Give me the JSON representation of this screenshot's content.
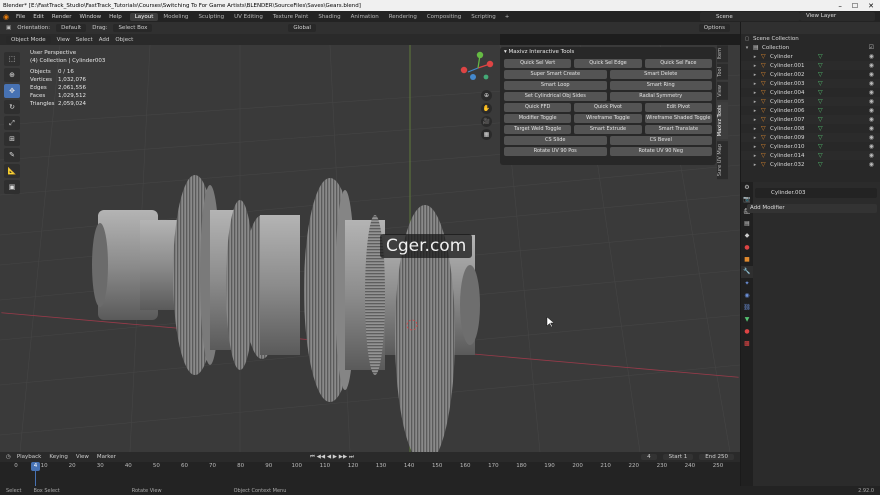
{
  "titlebar": {
    "title": "Blender* [E:\\FastTrack_Studio\\FastTrack_Tutorials\\Courses\\Switching To For Game Artists\\BLENDER\\SourceFiles\\Saves\\Gears.blend]"
  },
  "menu": [
    "File",
    "Edit",
    "Render",
    "Window",
    "Help"
  ],
  "workspaces": [
    "Layout",
    "Modeling",
    "Sculpting",
    "UV Editing",
    "Texture Paint",
    "Shading",
    "Animation",
    "Rendering",
    "Compositing",
    "Scripting"
  ],
  "active_workspace": "Layout",
  "scene": "Scene",
  "view_layer": "View Layer",
  "header1": {
    "orientation_label": "Orientation:",
    "orientation": "Default",
    "drag_label": "Drag:",
    "drag": "Select Box",
    "transform": "Global",
    "options": "Options"
  },
  "header2": {
    "mode": "Object Mode",
    "view": "View",
    "select": "Select",
    "add": "Add",
    "object": "Object"
  },
  "stats": {
    "view_name": "User Perspective",
    "collection": "(4) Collection | Cylinder003",
    "rows": [
      {
        "k": "Objects",
        "v": "0 / 16"
      },
      {
        "k": "Vertices",
        "v": "1,032,076"
      },
      {
        "k": "Edges",
        "v": "2,061,556"
      },
      {
        "k": "Faces",
        "v": "1,029,512"
      },
      {
        "k": "Triangles",
        "v": "2,059,024"
      }
    ]
  },
  "npanel": {
    "title": "Maxivz Interactive Tools",
    "grid3": [
      "Quick Sel Vert",
      "Quick Sel Edge",
      "Quick Sel Face",
      "Super Smart Create",
      "",
      "Smart Delete",
      "Smart Loop",
      "",
      "Smart Ring",
      "Set Cylindrical Obj Sides",
      "",
      "Radial Symmetry",
      "Quick FFD",
      "Quick Pivot",
      "Edit Pivot",
      "Modifier Toggle",
      "Wireframe Toggle",
      "Wireframe Shaded Toggle",
      "Target Weld Toggle",
      "Smart Extrude",
      "Smart Translate",
      "CS Slide",
      "",
      "CS Bevel",
      "Rotate UV 90 Pos",
      "",
      "Rotate UV 90 Neg"
    ]
  },
  "vtabs": [
    "Item",
    "Tool",
    "View",
    "Maxivz Tools",
    "Sure UV Map"
  ],
  "watermark": "Cger.com",
  "outliner": {
    "scene_collection": "Scene Collection",
    "collection": "Collection",
    "objects": [
      "Cylinder",
      "Cylinder.001",
      "Cylinder.002",
      "Cylinder.003",
      "Cylinder.004",
      "Cylinder.005",
      "Cylinder.006",
      "Cylinder.007",
      "Cylinder.008",
      "Cylinder.009",
      "Cylinder.010",
      "Cylinder.014",
      "Cylinder.032"
    ]
  },
  "properties": {
    "object_name": "Cylinder.003",
    "add_modifier": "Add Modifier"
  },
  "timeline": {
    "menu": [
      "Playback",
      "Keying",
      "View",
      "Marker"
    ],
    "current_frame": "4",
    "start_label": "Start",
    "start": "1",
    "end_label": "End",
    "end": "250",
    "ticks": [
      "0",
      "10",
      "20",
      "30",
      "40",
      "50",
      "60",
      "70",
      "80",
      "90",
      "100",
      "110",
      "120",
      "130",
      "140",
      "150",
      "160",
      "170",
      "180",
      "190",
      "200",
      "210",
      "220",
      "230",
      "240",
      "250"
    ]
  },
  "status": {
    "select": "Select",
    "box_select": "Box Select",
    "rotate_view": "Rotate View",
    "context_menu": "Object Context Menu",
    "version": "2.92.0"
  },
  "colors": {
    "accent": "#4772b3",
    "object_orange": "#e08a2e",
    "modifier_green": "#55c472"
  }
}
